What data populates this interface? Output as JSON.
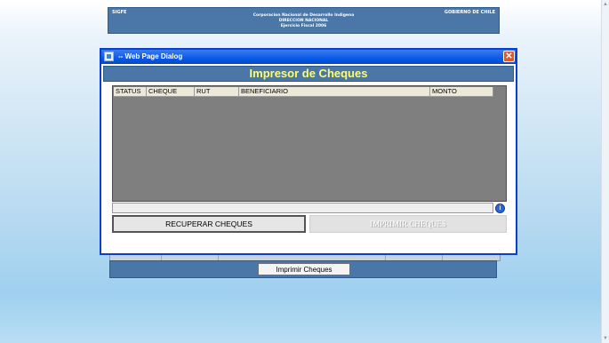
{
  "banner": {
    "left_label": "SIGFE",
    "right_label": "GOBIERNO DE CHILE",
    "line1": "Corporacion Nacional de Desarrollo Indigena",
    "line2": "DIRECCION NACIONAL",
    "line3": "Ejercicio Fiscal 2006"
  },
  "dialog": {
    "title": "-- Web Page Dialog",
    "close_glyph": "✕",
    "header": "Impresor de Cheques",
    "columns": [
      "STATUS",
      "CHEQUE",
      "RUT",
      "BENEFICIARIO",
      "MONTO"
    ],
    "info_glyph": "i",
    "recuperar_label": "RECUPERAR CHEQUES",
    "imprimir_label": "IMPRIMIR CHEQUES"
  },
  "background": {
    "print_button_label": "Imprimir Cheques"
  },
  "colors": {
    "banner": "#4a77a8",
    "header_text": "#ffff66",
    "titlebar": "#0b5ae6",
    "grid_bg": "#7f7f7f"
  },
  "icons": {
    "titlebar": "web-page-dialog-icon",
    "close": "close-icon",
    "info": "info-icon"
  }
}
